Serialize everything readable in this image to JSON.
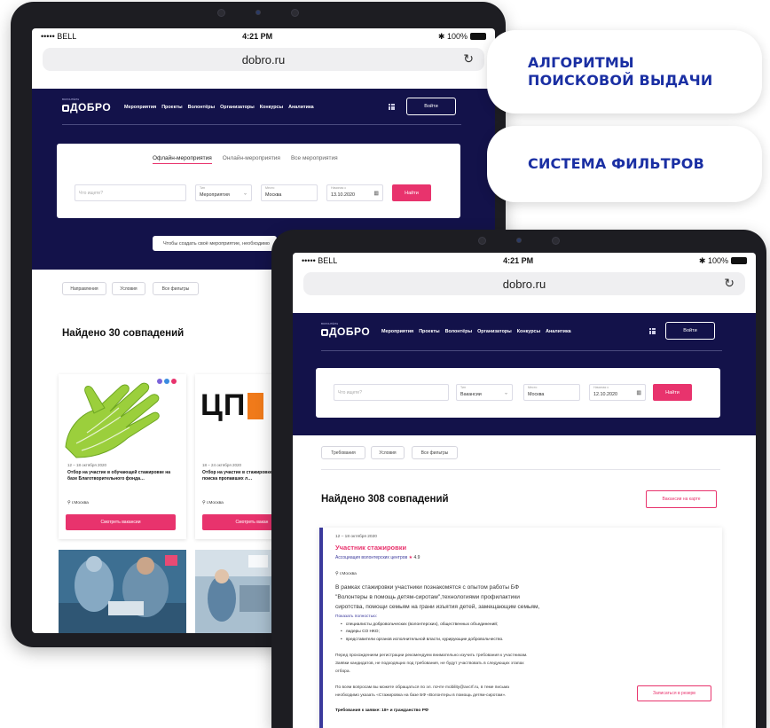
{
  "pills": {
    "first_line1": "АЛГОРИТМЫ",
    "first_line2": "ПОИСКОВОЙ ВЫДАЧИ",
    "second": "СИСТЕМА ФИЛЬТРОВ"
  },
  "colors": {
    "navy": "#13124a",
    "pink": "#e8336d",
    "accent_blue": "#1a2fa3"
  },
  "back_tablet": {
    "status": {
      "carrier": "••••• BELL",
      "time": "4:21 PM",
      "battery": "100%"
    },
    "url": "dobro.ru",
    "logo": "ДОБРО",
    "logo_sub": "ВОЛОНТЁРЫ",
    "nav": [
      "Мероприятия",
      "Проекты",
      "Волонтёры",
      "Организаторы",
      "Конкурсы",
      "Аналитика"
    ],
    "login": "Войти",
    "tabs": [
      "Офлайн-мероприятия",
      "Онлайн-мероприятия",
      "Все мероприятия"
    ],
    "search": {
      "placeholder": "Что ищете?",
      "type_label": "Тип",
      "type_value": "Мероприятия",
      "place_label": "Место",
      "place_value": "Москва",
      "date_label": "Начиная с",
      "date_value": "13.10.2020",
      "find": "Найти"
    },
    "create_pill": "Чтобы создать своё мероприятие, необходимо",
    "filters": [
      "Направления",
      "Условия",
      "Все фильтры"
    ],
    "found": "Найдено 30 совпадений",
    "cards": [
      {
        "date": "12 – 18 октября 2020",
        "title": "Отбор на участие в обучающей стажировке на базе Благотворительного фонда…",
        "location": "г.Москва",
        "cta": "Смотреть вакансии"
      },
      {
        "date": "18 – 24 октября 2020",
        "title": "Отбор на участие в стажировке на базе поиска пропавших л…",
        "location": "г.Москва",
        "cta": "Смотреть вакан",
        "logo_text": "ЦП"
      }
    ]
  },
  "front_tablet": {
    "status": {
      "carrier": "••••• BELL",
      "time": "4:21 PM",
      "battery": "100%"
    },
    "url": "dobro.ru",
    "logo": "ДОБРО",
    "logo_sub": "ВОЛОНТЁРЫ",
    "nav": [
      "Мероприятия",
      "Проекты",
      "Волонтёры",
      "Организаторы",
      "Конкурсы",
      "Аналитика"
    ],
    "login": "Войти",
    "search": {
      "placeholder": "Что ищете?",
      "type_label": "Тип",
      "type_value": "Вакансии",
      "place_label": "Место",
      "place_value": "Москва",
      "date_label": "Начиная с",
      "date_value": "12.10.2020",
      "find": "Найти"
    },
    "filters": [
      "Требования",
      "Условия",
      "Все фильтры"
    ],
    "found": "Найдено 308 совпадений",
    "map_button": "Вакансии на карте",
    "vacancy": {
      "date": "12 – 18 октября 2020",
      "title": "Участник стажировки",
      "org": "Ассоциация волонтерских центров",
      "rating": "4.9",
      "location": "г.Москва",
      "desc1": "В рамках стажировки участники познакомятся с опытом работы БФ",
      "desc2": "\"Волонтеры в помощь детям-сиротам\",технологиями профилактики",
      "desc3": "сиротства, помощи семьям на грани изъятия детей, замещающим семьям,",
      "show_more": "Показать полностью:",
      "bullets": [
        "специалисты добровольческих (волонтерских), общественных объединений;",
        "лидеры СО НКО;",
        "представители органов исполнительной власти, курирующие добровольчество."
      ],
      "p1a": "Перед прохождением регистрации рекомендуем внимательно изучить требования к участникам.",
      "p1b": "Заявки кандидатов, не подходящих под требования, не будут участвовать в следующих этапах",
      "p1c": "отбора.",
      "p2a": "По всем вопросам вы можете обращаться по эл. почте mobility@avcrf.ru, в теме письма",
      "p2b": "необходимо указать «Стажировка на базе БФ «Волонтеры в помощь детям-сиротам».",
      "requirements": "Требования к заявке: 18+ и гражданство РФ",
      "reserve_button": "Записаться в резерв"
    }
  }
}
